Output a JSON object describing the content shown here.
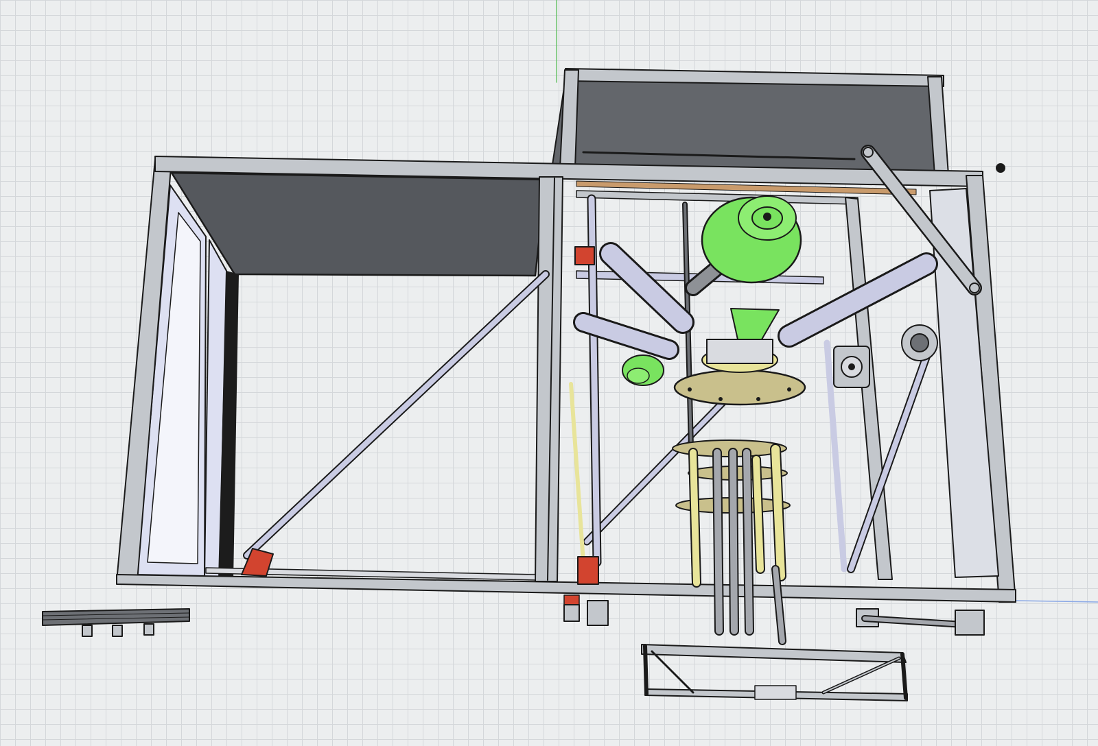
{
  "scene": {
    "kind": "cad-3d-model-view",
    "background": "grid",
    "colors": {
      "background": "#eceeef",
      "grid": "#d4d7da",
      "axis_vertical": "#6cc46c",
      "axis_horizontal": "#8aa8e6",
      "frame": "#c3c7cc",
      "frame_edge": "#1a1a1a",
      "dark_panel": "#5a5d62",
      "glass": "#dde0f2",
      "rod": "#c9cbe3",
      "bracket": "#d2442f",
      "motor": "#79e35f",
      "platform": "#c9c08c",
      "pillar": "#e8e49a",
      "wood_strip": "#c99b6c"
    }
  }
}
